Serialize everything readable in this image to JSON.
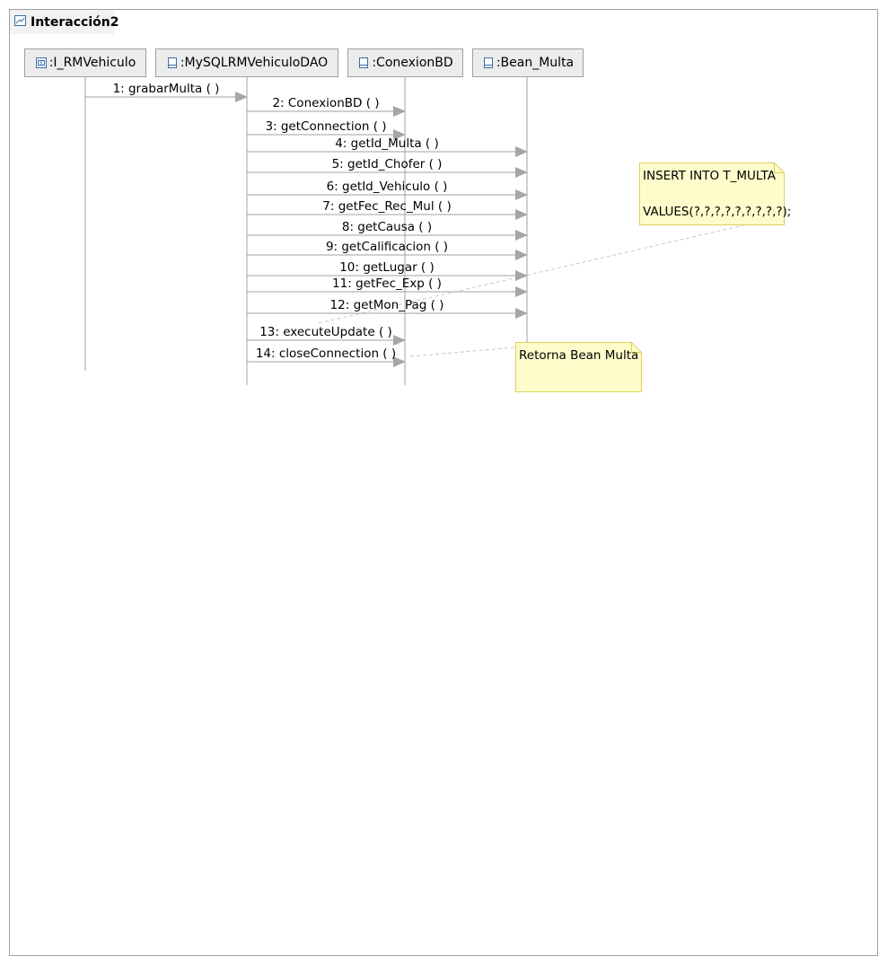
{
  "frame": {
    "title": "Interacción2"
  },
  "lifelines": [
    {
      "id": "i_rmvehiculo",
      "label": ":I_RMVehiculo",
      "icon": "interface-icon"
    },
    {
      "id": "mysql_dao",
      "label": ":MySQLRMVehiculoDAO",
      "icon": "class-icon"
    },
    {
      "id": "conexionbd",
      "label": ":ConexionBD",
      "icon": "class-icon"
    },
    {
      "id": "bean_multa",
      "label": ":Bean_Multa",
      "icon": "class-icon"
    }
  ],
  "messages": [
    {
      "label": "1: grabarMulta ( )",
      "from": "i_rmvehiculo",
      "to": "mysql_dao"
    },
    {
      "label": "2: ConexionBD ( )",
      "from": "mysql_dao",
      "to": "conexionbd"
    },
    {
      "label": "3: getConnection ( )",
      "from": "mysql_dao",
      "to": "conexionbd"
    },
    {
      "label": "4: getId_Multa ( )",
      "from": "mysql_dao",
      "to": "bean_multa"
    },
    {
      "label": "5: getId_Chofer ( )",
      "from": "mysql_dao",
      "to": "bean_multa"
    },
    {
      "label": "6: getId_Vehiculo ( )",
      "from": "mysql_dao",
      "to": "bean_multa"
    },
    {
      "label": "7: getFec_Rec_Mul ( )",
      "from": "mysql_dao",
      "to": "bean_multa"
    },
    {
      "label": "8: getCausa ( )",
      "from": "mysql_dao",
      "to": "bean_multa"
    },
    {
      "label": "9: getCalificacion ( )",
      "from": "mysql_dao",
      "to": "bean_multa"
    },
    {
      "label": "10: getLugar ( )",
      "from": "mysql_dao",
      "to": "bean_multa"
    },
    {
      "label": "11: getFec_Exp ( )",
      "from": "mysql_dao",
      "to": "bean_multa"
    },
    {
      "label": "12: getMon_Pag ( )",
      "from": "mysql_dao",
      "to": "bean_multa"
    },
    {
      "label": "13: executeUpdate ( )",
      "from": "mysql_dao",
      "to": "conexionbd"
    },
    {
      "label": "14: closeConnection ( )",
      "from": "mysql_dao",
      "to": "conexionbd"
    }
  ],
  "notes": [
    {
      "id": "sql-note",
      "lines": [
        "INSERT INTO T_MULTA",
        "",
        "VALUES(?,?,?,?,?,?,?,?,?);"
      ],
      "attached_to": 13
    },
    {
      "id": "return-note",
      "lines": [
        "Retorna Bean Multa"
      ],
      "attached_to": 14
    }
  ],
  "colors": {
    "line": "#a0a0a0",
    "arrow": "#a6a6a6",
    "note_fill": "#fffccc",
    "note_border": "#e0cf5a",
    "header_fill": "#ececec",
    "icon": "#3a6ea5"
  }
}
